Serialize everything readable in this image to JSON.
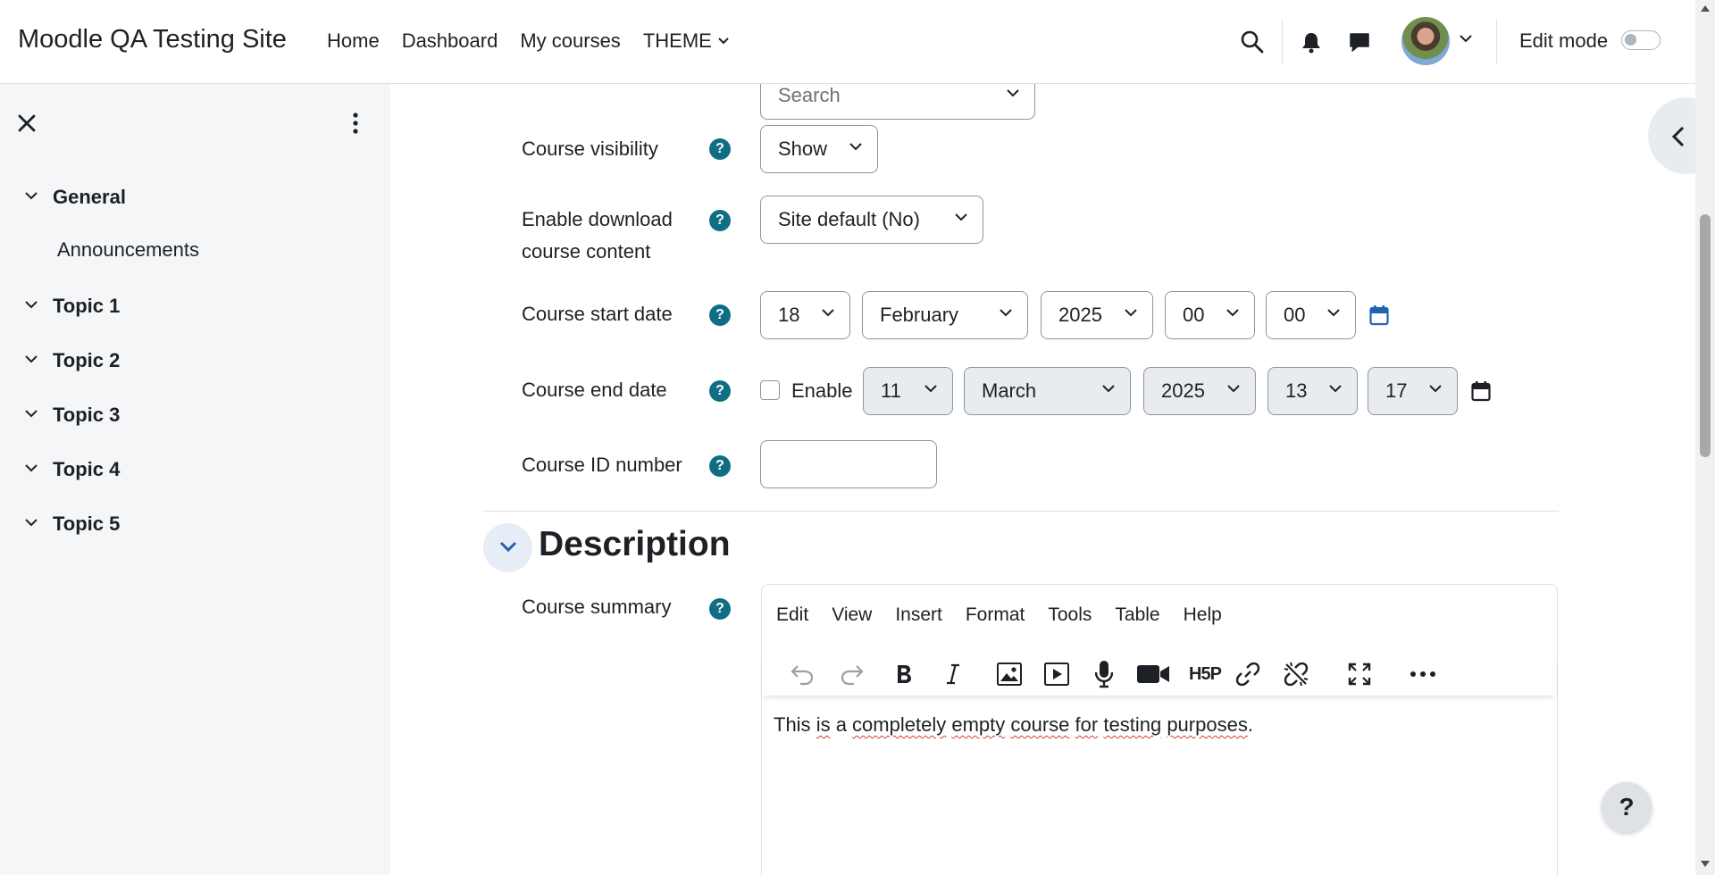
{
  "header": {
    "site_name": "Moodle QA Testing Site",
    "nav": [
      {
        "label": "Home"
      },
      {
        "label": "Dashboard"
      },
      {
        "label": "My courses"
      },
      {
        "label": "THEME",
        "has_dropdown": true
      }
    ],
    "icons": [
      "search-icon",
      "bell-icon",
      "chat-bubble-icon",
      "user-avatar",
      "chevron-down-icon"
    ],
    "edit_mode_label": "Edit mode",
    "edit_mode_on": false
  },
  "course_index": {
    "sections": [
      {
        "title": "General",
        "items": [
          "Announcements"
        ]
      },
      {
        "title": "Topic 1",
        "items": []
      },
      {
        "title": "Topic 2",
        "items": []
      },
      {
        "title": "Topic 3",
        "items": []
      },
      {
        "title": "Topic 4",
        "items": []
      },
      {
        "title": "Topic 5",
        "items": []
      }
    ]
  },
  "form": {
    "partial_top_select": "Search",
    "course_visibility": {
      "label": "Course visibility",
      "value": "Show"
    },
    "download_content": {
      "label": "Enable download course content",
      "line1": "Enable download",
      "line2": "course content",
      "value": "Site default (No)"
    },
    "start_date": {
      "label": "Course start date",
      "day": "18",
      "month": "February",
      "year": "2025",
      "hour": "00",
      "minute": "00"
    },
    "end_date": {
      "label": "Course end date",
      "enable_label": "Enable",
      "enabled": false,
      "day": "11",
      "month": "March",
      "year": "2025",
      "hour": "13",
      "minute": "17"
    },
    "id_number": {
      "label": "Course ID number",
      "value": ""
    }
  },
  "description": {
    "heading": "Description",
    "summary_label": "Course summary",
    "menubar": [
      "Edit",
      "View",
      "Insert",
      "Format",
      "Tools",
      "Table",
      "Help"
    ],
    "toolbar_icons": [
      "undo-icon",
      "redo-icon",
      "bold-icon",
      "italic-icon",
      "image-icon",
      "media-icon",
      "microphone-icon",
      "video-camera-icon",
      "h5p-icon",
      "link-icon",
      "unlink-icon",
      "fullscreen-icon",
      "more-icon"
    ],
    "h5p_text": "H5P",
    "content_words": [
      {
        "text": "This ",
        "spell": false
      },
      {
        "text": "is",
        "spell": true
      },
      {
        "text": " a ",
        "spell": false
      },
      {
        "text": "completely",
        "spell": true
      },
      {
        "text": " ",
        "spell": false
      },
      {
        "text": "empty",
        "spell": true
      },
      {
        "text": " ",
        "spell": false
      },
      {
        "text": "course",
        "spell": true
      },
      {
        "text": " ",
        "spell": false
      },
      {
        "text": "for",
        "spell": true
      },
      {
        "text": " ",
        "spell": false
      },
      {
        "text": "testing",
        "spell": true
      },
      {
        "text": " ",
        "spell": false
      },
      {
        "text": "purposes",
        "spell": true
      },
      {
        "text": ".",
        "spell": false
      }
    ]
  },
  "help_button": "?",
  "colors": {
    "help_icon": "#0f6e84",
    "calendar_active": "#1f63b1",
    "drawer_bg": "#f5f6f7"
  }
}
